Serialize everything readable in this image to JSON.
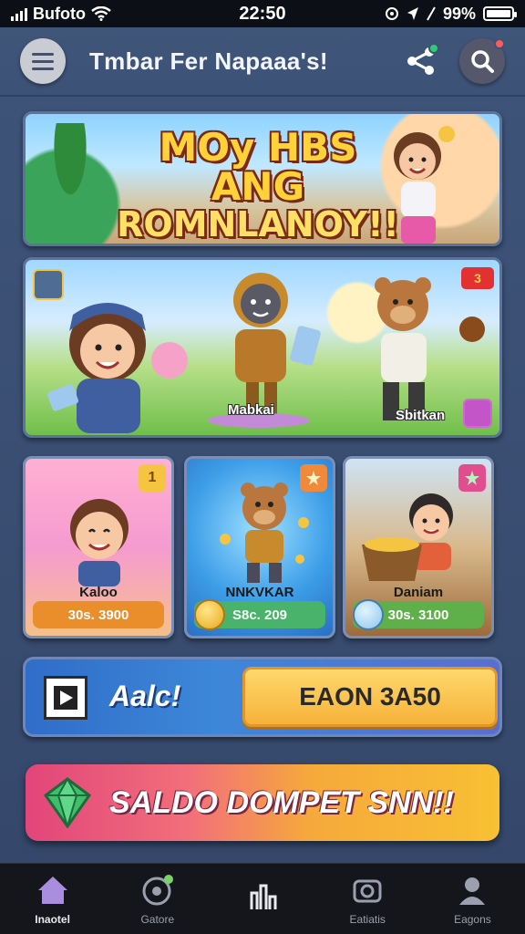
{
  "status_bar": {
    "carrier": "Bufoto",
    "time": "22:50",
    "battery": "99%",
    "battery_level": 0.99
  },
  "header": {
    "title": "Tmbar Fer Napaaa's!",
    "menu_icon": "menu-icon",
    "share_icon": "share-icon",
    "search_icon": "search-icon"
  },
  "banners": {
    "top": {
      "line1": "MOy HBS ANG",
      "line2": "ROMNLANOY!!"
    },
    "hero": {
      "tag": "3",
      "label_left": "Mabkai",
      "label_right": "Sbitkan"
    }
  },
  "game_cards": [
    {
      "name": "Kaloo",
      "price": "30s. 3900",
      "badge": "1"
    },
    {
      "name": "NNKVKAR",
      "price": "S8c. 209",
      "badge": "star"
    },
    {
      "name": "Daniam",
      "price": "30s. 3100",
      "badge": "star"
    }
  ],
  "action_bar": {
    "label": "Aalc!",
    "button": "EAON 3A50"
  },
  "wallet": {
    "label": "SALDO DOMPET SNN!!"
  },
  "bottom_nav": [
    {
      "label": "Inaotel",
      "icon": "home-icon",
      "active": true
    },
    {
      "label": "Gatore",
      "icon": "game-controller-icon",
      "active": false
    },
    {
      "label": "",
      "icon": "chart-icon",
      "active": false
    },
    {
      "label": "Eatiatis",
      "icon": "camera-icon",
      "active": false
    },
    {
      "label": "Eagons",
      "icon": "profile-icon",
      "active": false
    }
  ],
  "colors": {
    "background": "#3a4f73",
    "accent_orange": "#f6b23a",
    "accent_pink": "#e2457a",
    "nav_bg": "#14161c"
  }
}
